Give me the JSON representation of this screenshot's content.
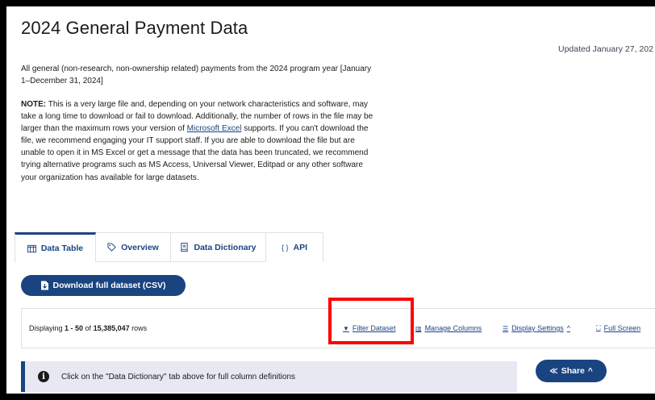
{
  "page": {
    "title": "2024 General Payment Data",
    "updated": "Updated January 27, 202",
    "description": "All general (non-research, non-ownership related) payments from the 2024 program year [January 1–December 31, 2024]",
    "note": {
      "label": "NOTE:",
      "text_before_link": " This is a very large file and, depending on your network characteristics and software, may take a long time to download or fail to download. Additionally, the number of rows in the file may be larger than the maximum rows your version of ",
      "link_text": "Microsoft Excel",
      "text_after_link": " supports. If you can't download the file, we recommend engaging your IT support staff. If you are able to download the file but are unable to open it in MS Excel or get a message that the data has been truncated, we recommend trying alternative programs such as MS Access, Universal Viewer, Editpad or any other software your organization has available for large datasets."
    }
  },
  "tabs": [
    {
      "label": "Data Table",
      "icon": "table-icon",
      "active": true
    },
    {
      "label": "Overview",
      "icon": "tag-icon",
      "active": false
    },
    {
      "label": "Data Dictionary",
      "icon": "book-icon",
      "active": false
    },
    {
      "label": "API",
      "icon": "code-icon",
      "active": false
    }
  ],
  "download": {
    "label": "Download full dataset (CSV)",
    "icon": "file-download-icon"
  },
  "toolbar": {
    "displaying_prefix": "Displaying ",
    "range": "1 - 50",
    "of": " of ",
    "total": "15,385,047",
    "suffix": " rows",
    "filter_label": "Filter Dataset",
    "manage_label": "Manage Columns",
    "display_label": "Display Settings",
    "fullscreen_label": "Full Screen"
  },
  "info": {
    "text": "Click on the \"Data Dictionary\" tab above for full column definitions"
  },
  "share": {
    "label": "Share"
  },
  "colors": {
    "primary": "#1a4480",
    "highlight": "#ff0000",
    "info_bg": "#e7e8f2"
  }
}
